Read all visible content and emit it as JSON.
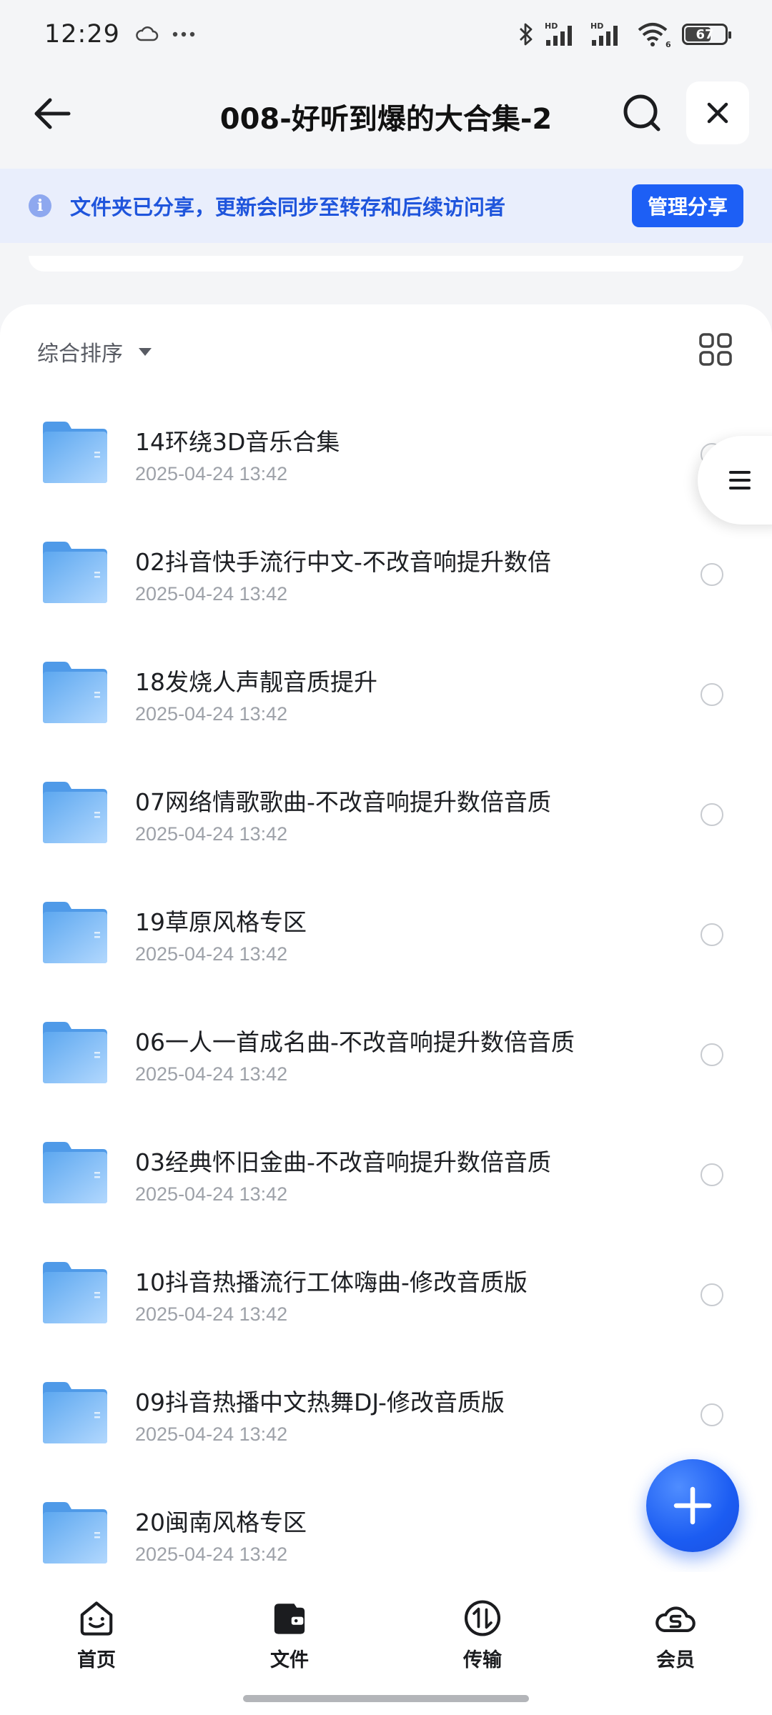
{
  "status_bar": {
    "time": "12:29",
    "battery": "67",
    "battery_level_percent": 67,
    "signal_1_label": "HD",
    "signal_2_label": "HD",
    "wifi_label": "6"
  },
  "header": {
    "title": "008-好听到爆的大合集-2",
    "back_icon": "arrow-left-icon",
    "search_icon": "search-icon",
    "close_icon": "close-icon"
  },
  "share_banner": {
    "text": "文件夹已分享，更新会同步至转存和后续访问者",
    "button": "管理分享",
    "info_icon": "i"
  },
  "list": {
    "sort_label": "综合排序",
    "items": [
      {
        "name": "14环绕3D音乐合集",
        "date": "2025-04-24 13:42"
      },
      {
        "name": "02抖音快手流行中文-不改音响提升数倍",
        "date": "2025-04-24 13:42"
      },
      {
        "name": "18发烧人声靓音质提升",
        "date": "2025-04-24 13:42"
      },
      {
        "name": "07网络情歌歌曲-不改音响提升数倍音质",
        "date": "2025-04-24 13:42"
      },
      {
        "name": "19草原风格专区",
        "date": "2025-04-24 13:42"
      },
      {
        "name": "06一人一首成名曲-不改音响提升数倍音质",
        "date": "2025-04-24 13:42"
      },
      {
        "name": "03经典怀旧金曲-不改音响提升数倍音质",
        "date": "2025-04-24 13:42"
      },
      {
        "name": "10抖音热播流行工体嗨曲-修改音质版",
        "date": "2025-04-24 13:42"
      },
      {
        "name": "09抖音热播中文热舞DJ-修改音质版",
        "date": "2025-04-24 13:42"
      },
      {
        "name": "20闽南风格专区",
        "date": "2025-04-24 13:42"
      }
    ]
  },
  "bottom_nav": [
    {
      "label": "首页",
      "icon": "home-smile-icon"
    },
    {
      "label": "文件",
      "icon": "wallet-folder-icon"
    },
    {
      "label": "传输",
      "icon": "transfer-icon"
    },
    {
      "label": "会员",
      "icon": "vip-cloud-icon"
    }
  ],
  "colors": {
    "accent": "#1d5ff5",
    "banner_bg": "#e9eefc",
    "folder": "#74b4f5"
  }
}
